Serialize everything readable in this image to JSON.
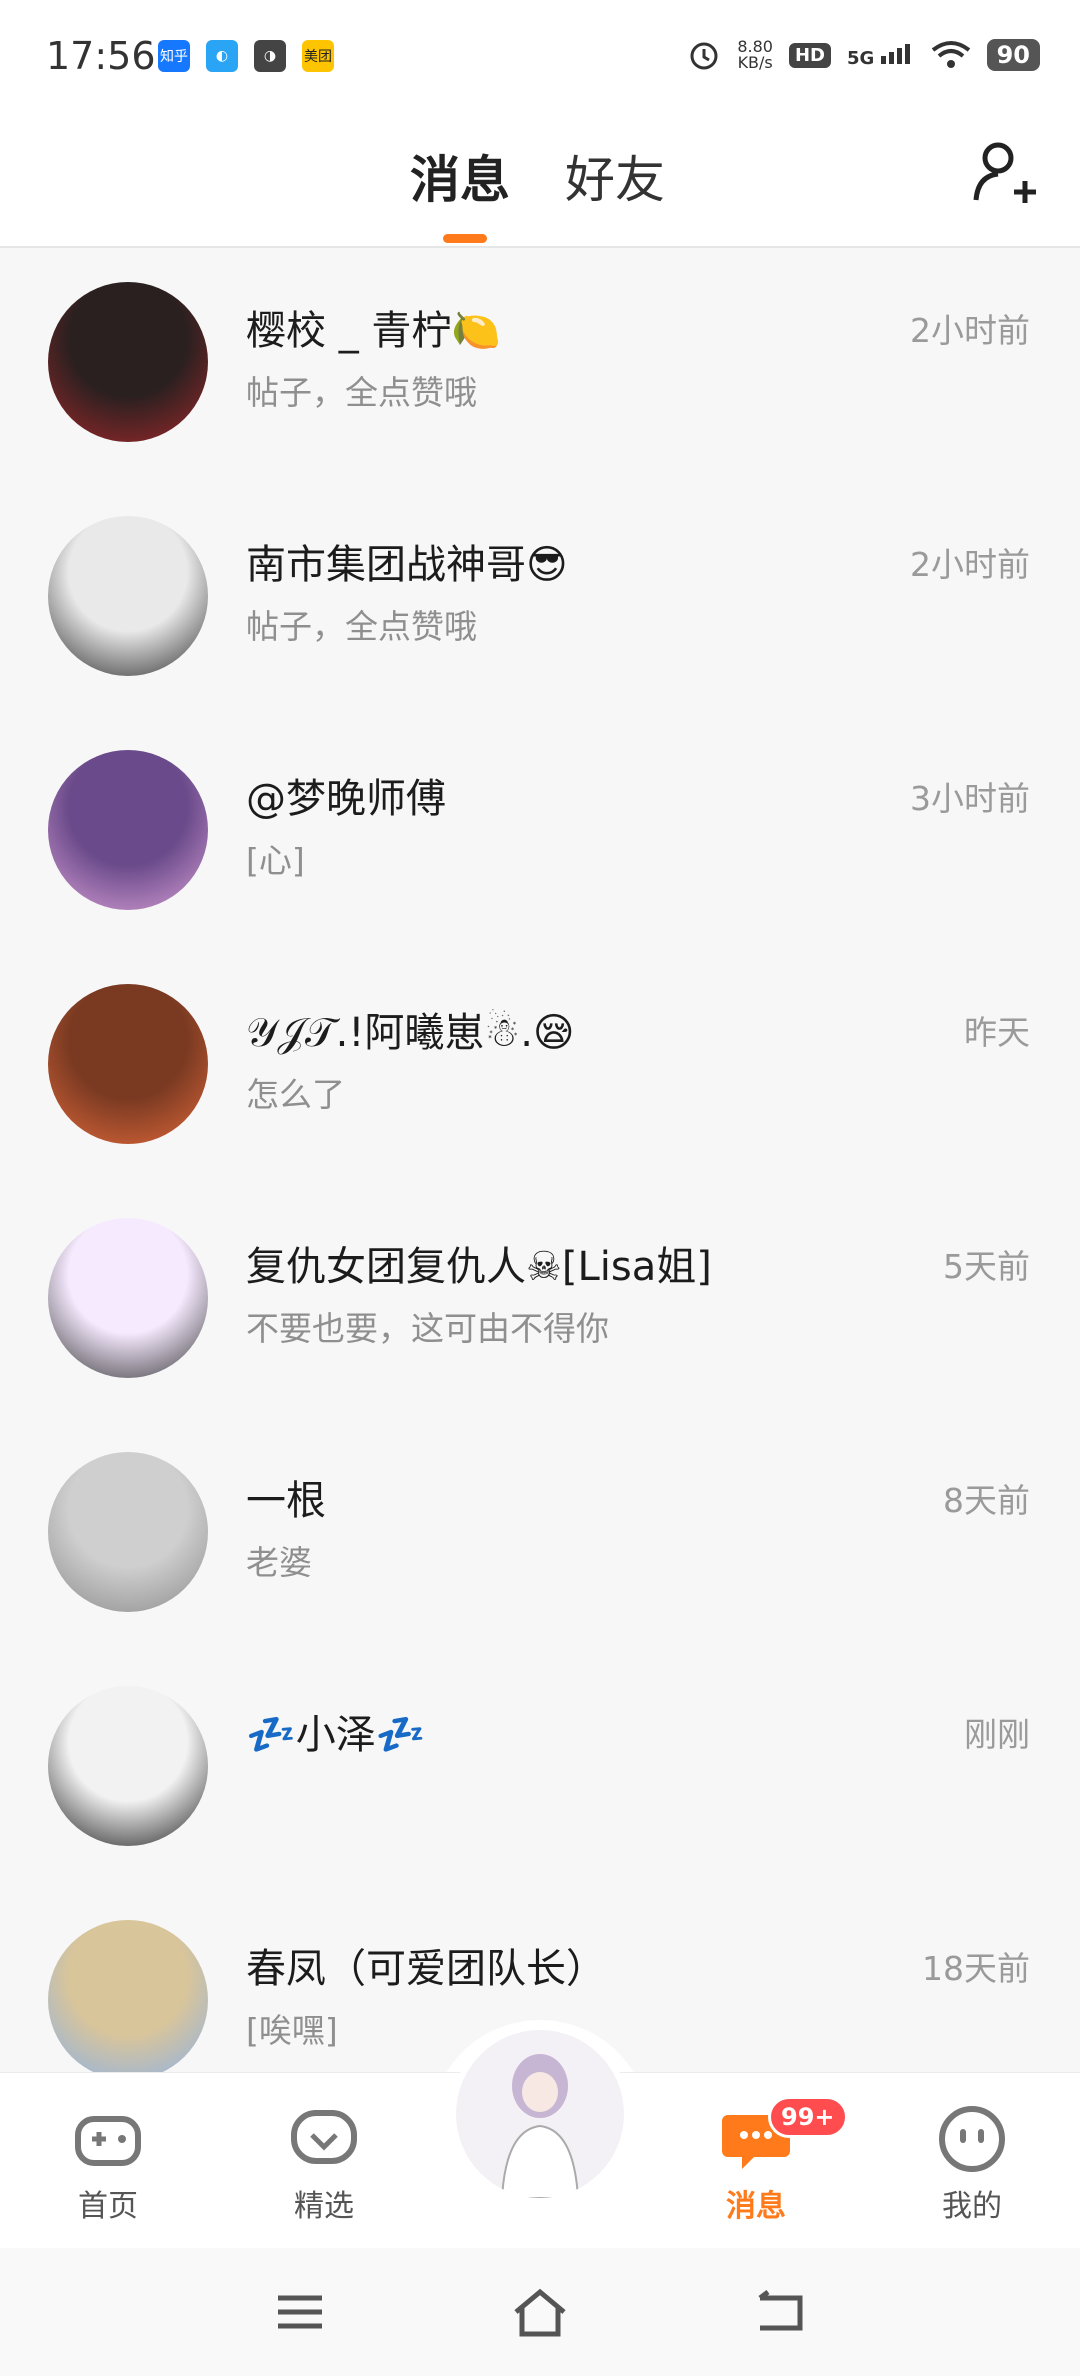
{
  "status_bar": {
    "time": "17:56",
    "apps": [
      {
        "label": "知乎",
        "color": "#1677ff"
      },
      {
        "label": "◐",
        "color": "#2aa4f4"
      },
      {
        "label": "◑",
        "color": "#444444"
      },
      {
        "label": "美团",
        "color": "#ffc400"
      }
    ],
    "net_speed_value": "8.80",
    "net_speed_unit": "KB/s",
    "hd": "HD",
    "signal": "5G",
    "battery": "90"
  },
  "header": {
    "tabs": [
      {
        "label": "消息",
        "active": true
      },
      {
        "label": "好友",
        "active": false
      }
    ],
    "accent_color": "#ff7a1a"
  },
  "conversations": [
    {
      "name": "樱校 _ 青柠🍋",
      "preview": "帖子，全点赞哦",
      "time": "2小时前",
      "avatar_colors": [
        "#2b2020",
        "#a0282a"
      ]
    },
    {
      "name": "南市集团战神哥😎",
      "preview": "帖子，全点赞哦",
      "time": "2小时前",
      "avatar_colors": [
        "#e9e9e9",
        "#2a2a2a"
      ]
    },
    {
      "name": "@梦晚师傅",
      "preview": "[心]",
      "time": "3小时前",
      "avatar_colors": [
        "#6a4a8a",
        "#d8a0d6"
      ]
    },
    {
      "name": "𝒴𝒥𝒯.!阿曦崽☃.😪",
      "preview": "怎么了",
      "time": "昨天",
      "avatar_colors": [
        "#7a3a22",
        "#e0683a"
      ]
    },
    {
      "name": "复仇女团复仇人☠[Lisa姐]",
      "preview": "不要也要，这可由不得你",
      "time": "5天前",
      "avatar_colors": [
        "#f6eaff",
        "#333333"
      ]
    },
    {
      "name": "一根",
      "preview": "老婆",
      "time": "8天前",
      "avatar_colors": [
        "#cfcfcf",
        "#8a8a8a"
      ]
    },
    {
      "name": "💤小泽💤",
      "preview": "",
      "time": "刚刚",
      "avatar_colors": [
        "#f2f2f2",
        "#1a1a1a"
      ]
    },
    {
      "name": "春凤（可爱团队长）",
      "preview": "[唉嘿]",
      "time": "18天前",
      "avatar_colors": [
        "#d9c59a",
        "#8ab0e8"
      ]
    }
  ],
  "bottom_nav": {
    "items": [
      {
        "label": "首页",
        "icon": "gamepad-icon",
        "active": false
      },
      {
        "label": "精选",
        "icon": "heart-chat-icon",
        "active": false
      },
      {
        "label": "消息",
        "icon": "message-icon",
        "active": true
      },
      {
        "label": "我的",
        "icon": "face-icon",
        "active": false
      }
    ],
    "badge": "99+"
  },
  "system_nav": [
    "menu-icon",
    "home-icon",
    "back-icon"
  ]
}
